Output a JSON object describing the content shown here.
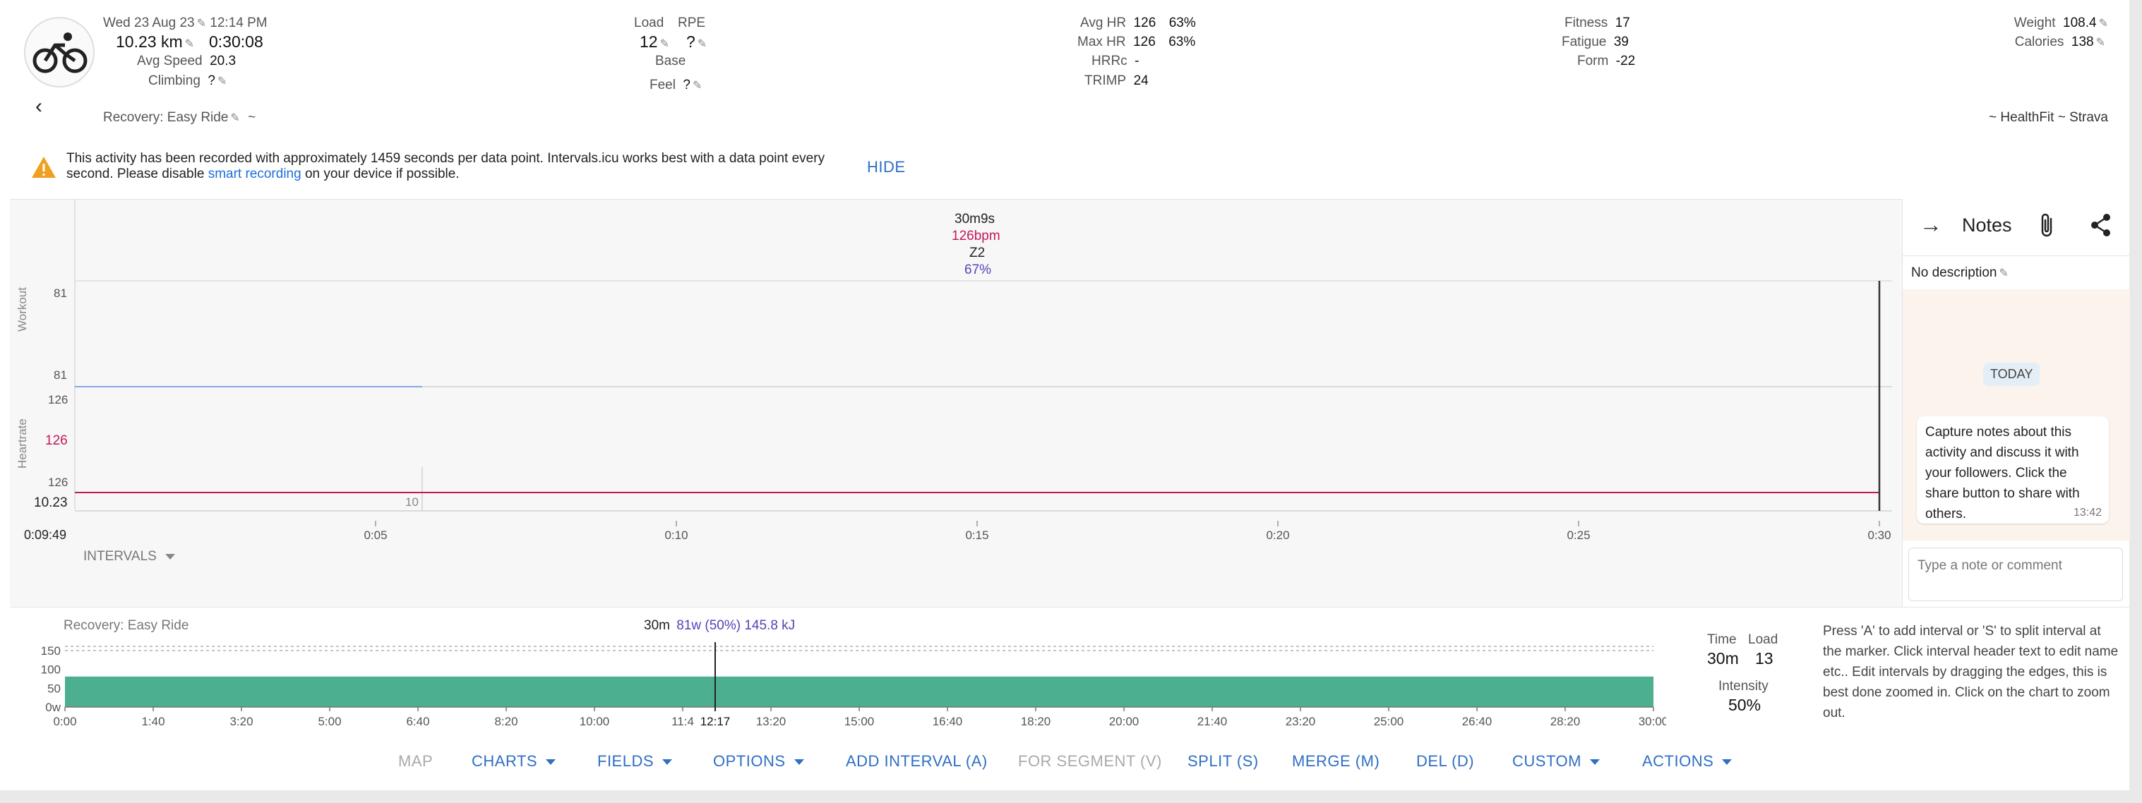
{
  "summary": {
    "date": "Wed 23 Aug 23",
    "time": "12:14 PM",
    "distance": "10.23 km",
    "duration": "0:30:08",
    "avg_speed_label": "Avg Speed",
    "avg_speed": "20.3",
    "climbing_label": "Climbing",
    "climbing": "?",
    "load_label": "Load",
    "load": "12",
    "rpe_label": "RPE",
    "rpe": "?",
    "base": "Base",
    "feel_label": "Feel",
    "feel": "?",
    "avg_hr_label": "Avg HR",
    "avg_hr": "126",
    "avg_hr_pct": "63%",
    "max_hr_label": "Max HR",
    "max_hr": "126",
    "max_hr_pct": "63%",
    "hrrc_label": "HRRc",
    "hrrc": "-",
    "trimp_label": "TRIMP",
    "trimp": "24",
    "fitness_label": "Fitness",
    "fitness": "17",
    "fatigue_label": "Fatigue",
    "fatigue": "39",
    "form_label": "Form",
    "form": "-22",
    "weight_label": "Weight",
    "weight": "108.4",
    "calories_label": "Calories",
    "calories": "138",
    "activity_name": "Recovery: Easy Ride",
    "tilde": "~",
    "source": "~ HealthFit ~ Strava"
  },
  "warning": {
    "line1": "This activity has been recorded with approximately 1459 seconds per data point. Intervals.icu works best with a data point every",
    "line2_pre": "second. Please disable ",
    "line2_link": "smart recording",
    "line2_post": " on your device if possible.",
    "hide": "HIDE"
  },
  "chart": {
    "tooltip_duration": "30m9s",
    "tooltip_hr": "126bpm",
    "tooltip_zone": "Z2",
    "tooltip_pct": "67%",
    "workout_label": "Workout",
    "workout_top": "81",
    "workout_bottom": "81",
    "heartrate_label": "Heartrate",
    "hr_top": "126",
    "hr_mid": "126",
    "hr_bottom": "126",
    "distance_marker": "10.23",
    "distance_tick": "10",
    "time_cursor": "0:09:49",
    "ticks": [
      "0:05",
      "0:10",
      "0:15",
      "0:20",
      "0:25",
      "0:30"
    ],
    "intervals_label": "INTERVALS",
    "hr_color": "#c2185b",
    "workout_color": "#8aa4e8"
  },
  "notes": {
    "title": "Notes",
    "no_description": "No description",
    "today": "TODAY",
    "message": "Capture notes about this activity and discuss it with your followers. Click the share button to share with others.",
    "message_time": "13:42",
    "input_placeholder": "Type a note or comment"
  },
  "interval_chart": {
    "name": "Recovery: Easy Ride",
    "duration": "30m",
    "power_info": "81w (50%) 145.8 kJ",
    "y_ticks": [
      "150",
      "100",
      "50",
      "0w"
    ],
    "x_ticks": [
      "0:00",
      "1:40",
      "3:20",
      "5:00",
      "6:40",
      "8:20",
      "10:00",
      "11:4",
      "13:20",
      "15:00",
      "16:40",
      "18:20",
      "20:00",
      "21:40",
      "23:20",
      "25:00",
      "26:40",
      "28:20",
      "30:00"
    ],
    "cursor_time": "12:17",
    "power_value": 81,
    "power_max": 150,
    "bar_color": "#4caf8f"
  },
  "interval_stats": {
    "time_label": "Time",
    "time": "30m",
    "load_label": "Load",
    "load": "13",
    "intensity_label": "Intensity",
    "intensity": "50%"
  },
  "help_text": "Press 'A' to add interval or 'S' to split interval at the marker. Click interval header text to edit name etc.. Edit intervals by dragging the edges, this is best done zoomed in. Click on the chart to zoom out.",
  "toolbar": {
    "map": "MAP",
    "charts": "CHARTS",
    "fields": "FIELDS",
    "options": "OPTIONS",
    "add_interval": "ADD INTERVAL (A)",
    "for_segment": "FOR SEGMENT (V)",
    "split": "SPLIT (S)",
    "merge": "MERGE (M)",
    "del": "DEL (D)",
    "custom": "CUSTOM",
    "actions": "ACTIONS"
  }
}
